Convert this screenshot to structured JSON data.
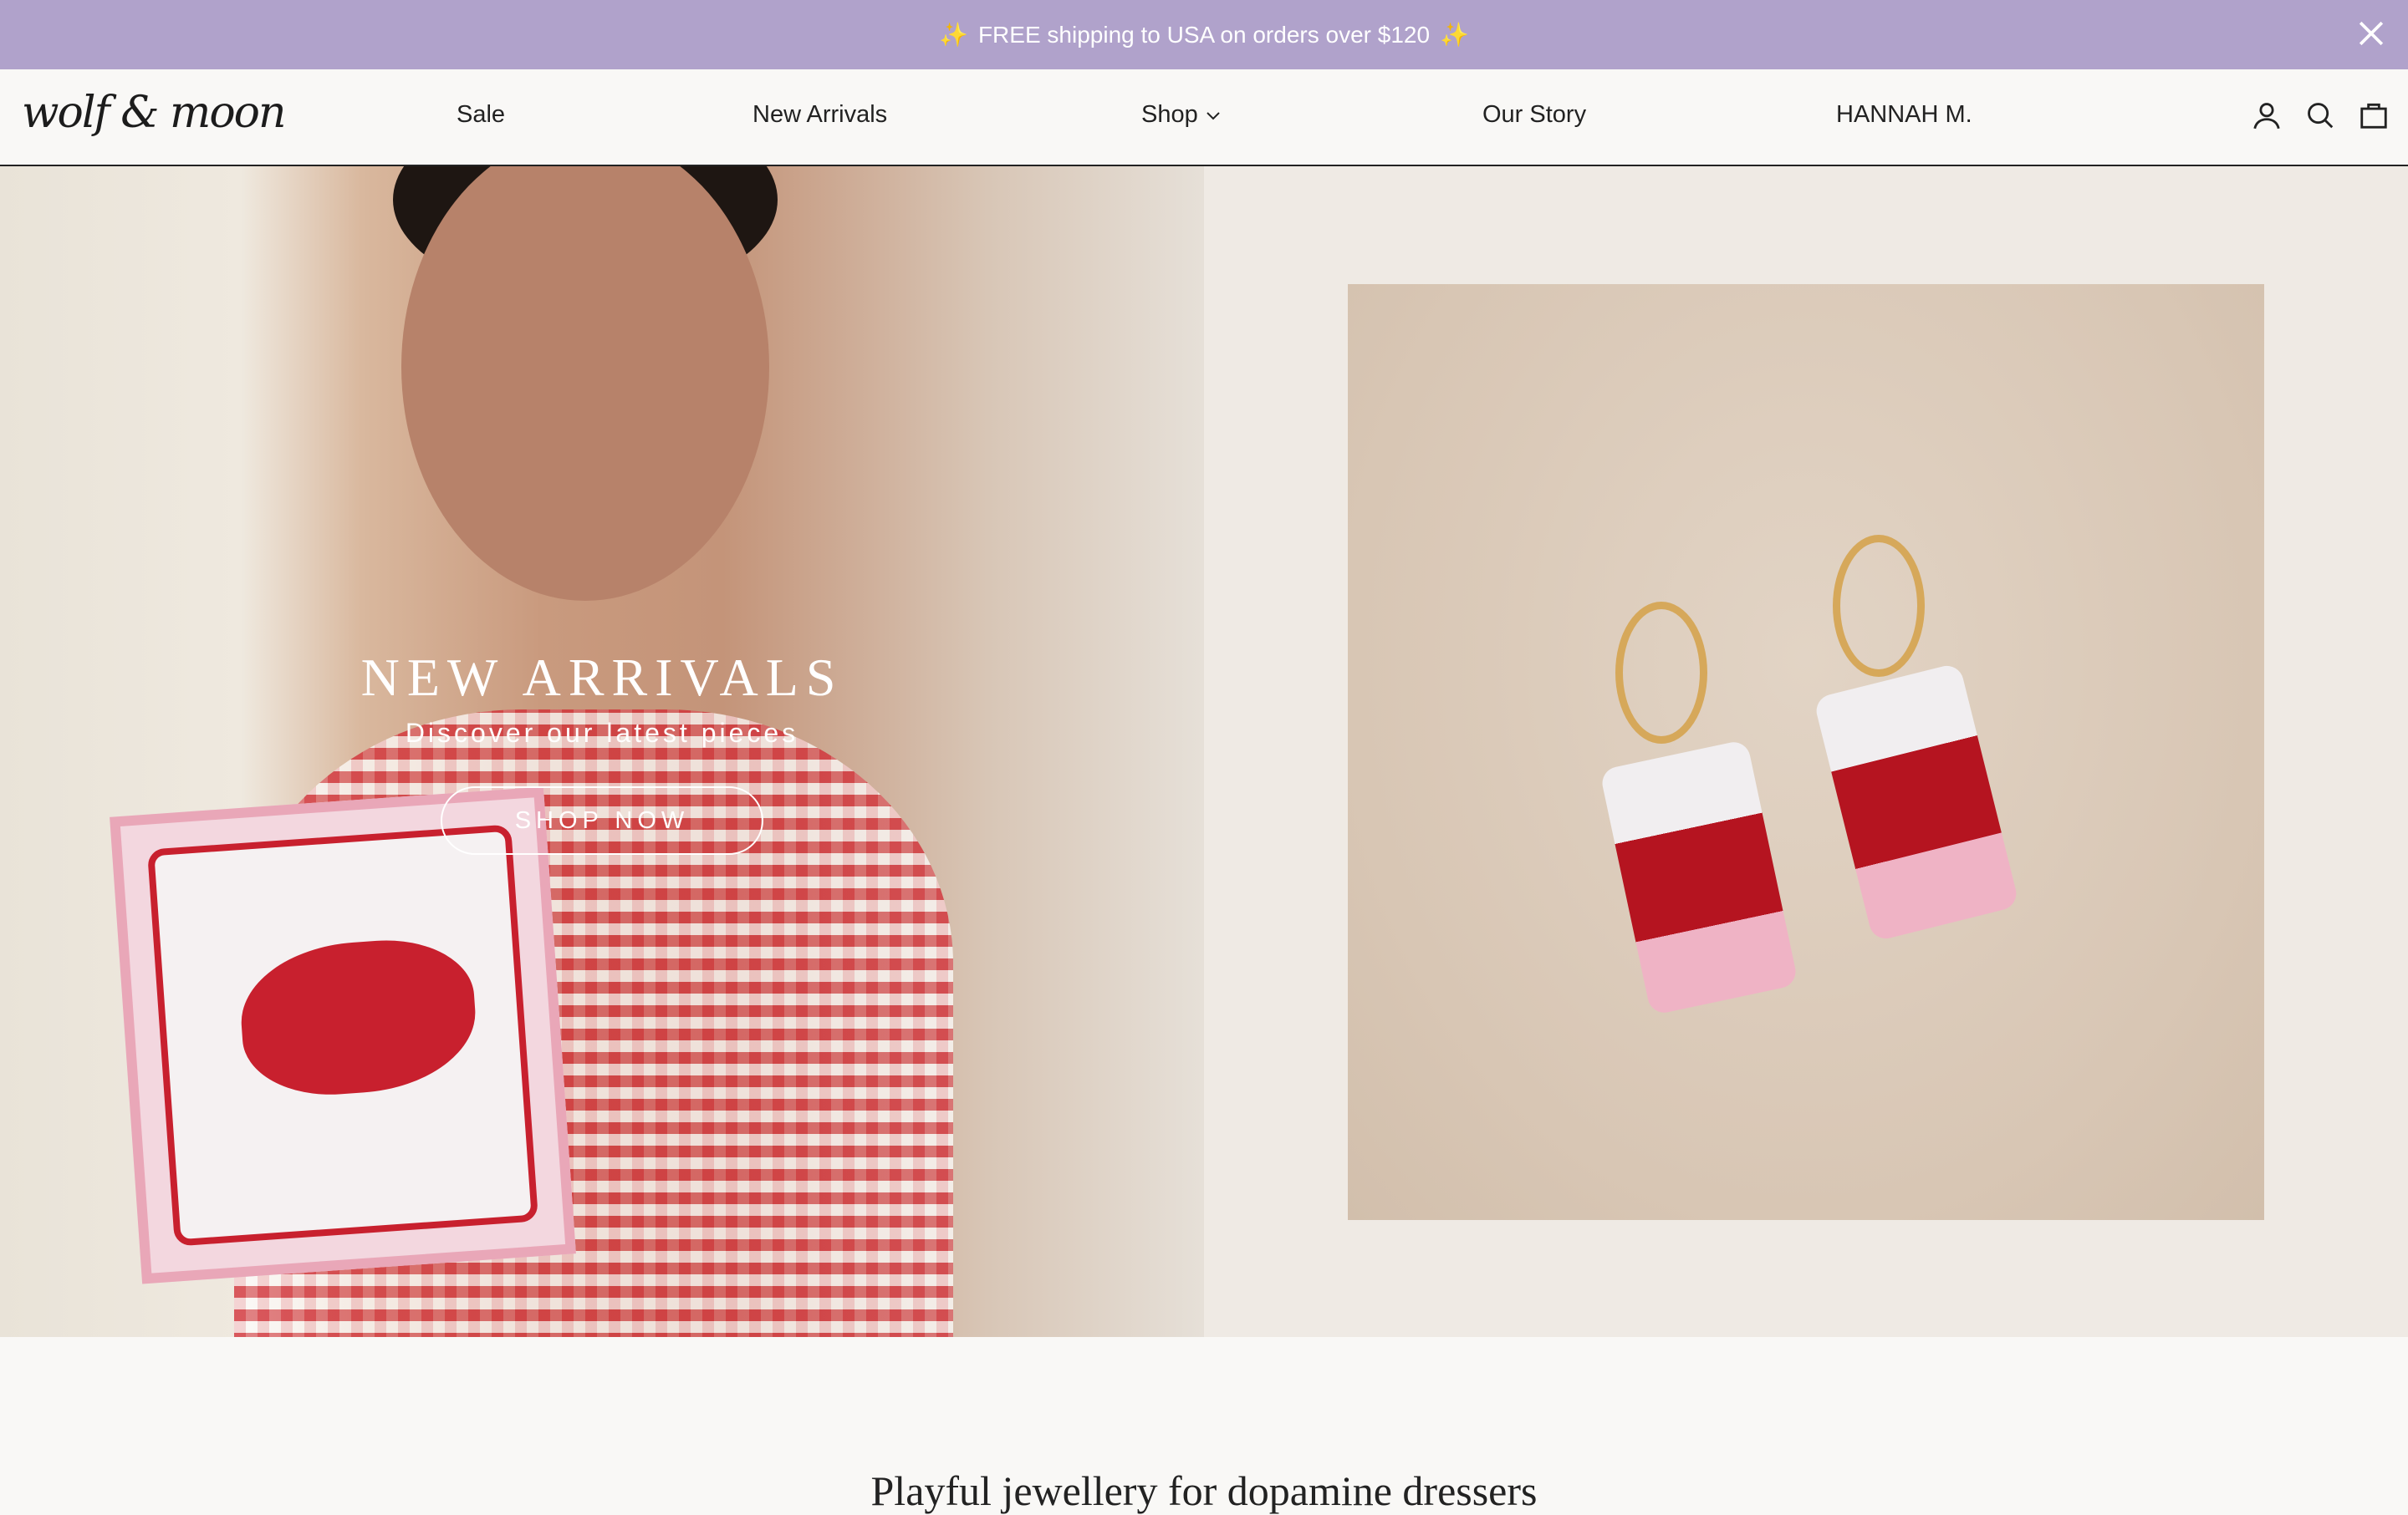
{
  "announcement": {
    "text": "FREE shipping to USA on orders over $120",
    "sparkle": "✨",
    "close_icon": "close-icon"
  },
  "header": {
    "logo": "wolf & moon",
    "nav": [
      {
        "label": "Sale"
      },
      {
        "label": "New Arrivals"
      },
      {
        "label": "Shop"
      },
      {
        "label": "Our Story"
      },
      {
        "label": "HANNAH M."
      }
    ],
    "icons": [
      "account-icon",
      "search-icon",
      "bag-icon"
    ]
  },
  "hero": {
    "title": "NEW ARRIVALS",
    "subtitle": "Discover our latest pieces",
    "cta": "SHOP NOW"
  },
  "section": {
    "heading": "Playful jewellery for dopamine dressers"
  },
  "colors": {
    "banner": "#b0a2cb",
    "right_panel": "#efeae4"
  }
}
